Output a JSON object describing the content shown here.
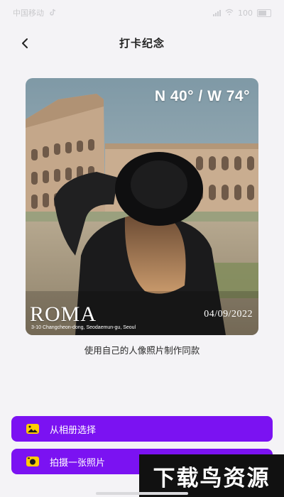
{
  "status_bar": {
    "left_text": "中国移动",
    "right_text": "100"
  },
  "header": {
    "title": "打卡纪念"
  },
  "photo": {
    "coordinates": "N 40° / W 74°",
    "city": "ROMA",
    "address": "3-10 Changcheon-dong, Seodaemun-gu, Seoul",
    "date": "04/09/2022"
  },
  "caption": "使用自己的人像照片制作同款",
  "buttons": {
    "album_label": "从相册选择",
    "camera_label": "拍摄一张照片"
  },
  "watermark": "下载鸟资源",
  "colors": {
    "accent": "#7b12f2",
    "background": "#f4f3f6",
    "button_icon": "#ffcc00"
  }
}
